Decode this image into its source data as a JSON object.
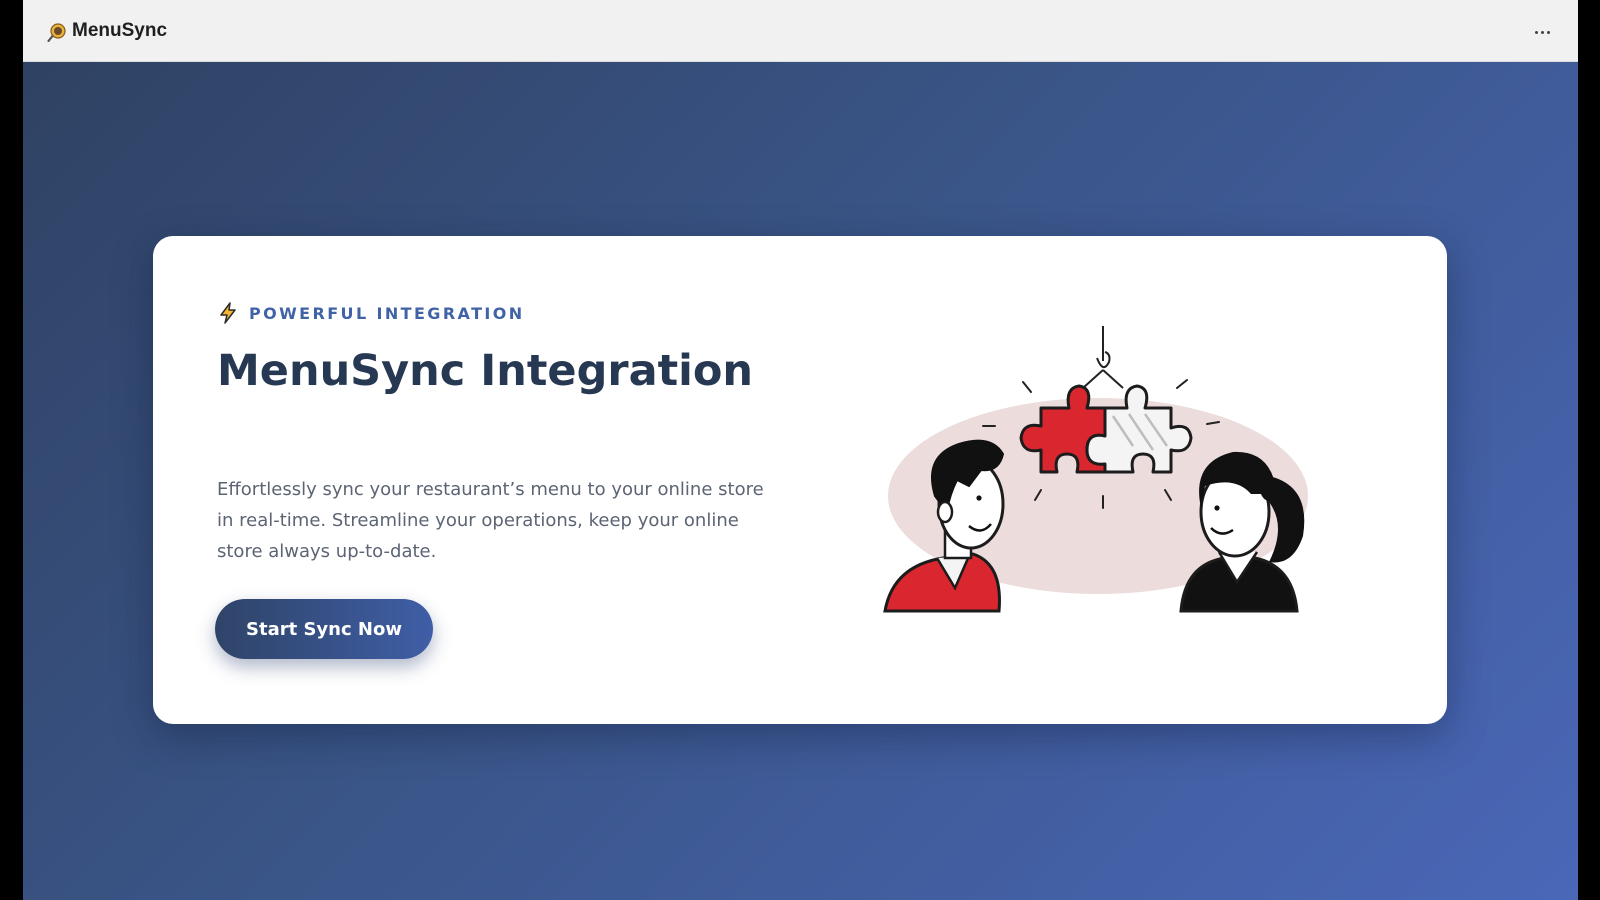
{
  "window": {
    "app_title": "MenuSync",
    "more_label": "…"
  },
  "hero": {
    "eyebrow": "POWERFUL INTEGRATION",
    "title": "MenuSync Integration",
    "description": "Effortlessly sync your restaurant’s menu to your online store in real-time. Streamline your operations, keep your online store always up-to-date.",
    "cta_label": "Start Sync Now"
  },
  "colors": {
    "accent": "#4062a6",
    "title": "#263852",
    "puzzle_red": "#d9262f",
    "background_start": "#2f4263",
    "background_end": "#4a67b8"
  },
  "icons": {
    "app_logo": "magnifier-logo-icon",
    "eyebrow": "lightning-bolt-icon",
    "menu": "more-options-icon"
  }
}
